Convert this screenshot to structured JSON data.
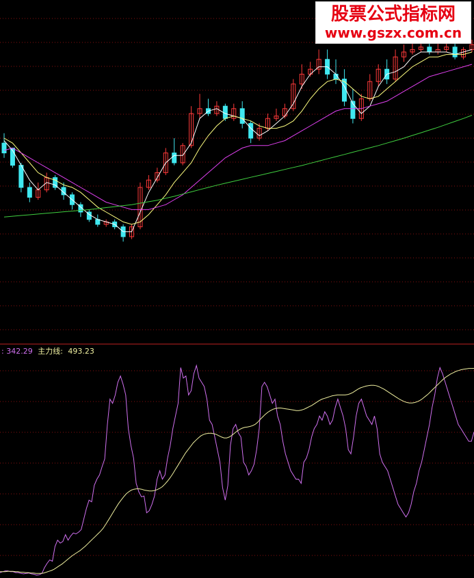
{
  "watermark": {
    "title": "股票公式指标网",
    "url": "www.gszx.com.cn"
  },
  "indicator_legend": {
    "fast_value": ": 342.29",
    "main_label": "主力线: ",
    "main_value": "493.23"
  },
  "colors": {
    "background": "#000000",
    "up": "#ff3a3a",
    "down": "#40e8f0",
    "ma_short": "#ffffff",
    "ma_mid": "#ffff80",
    "ma_long": "#e040f0",
    "ma_very_long": "#40d040",
    "fast_line": "#d070f0",
    "main_line": "#f0f0a0",
    "grid": "#8a1010",
    "separator": "#c02020"
  },
  "chart_data": [
    {
      "type": "candlestick",
      "title": "",
      "grid": true,
      "ylim": [
        0,
        100
      ],
      "candles": [
        [
          58,
          62,
          54,
          52
        ],
        [
          56,
          55,
          49,
          48
        ],
        [
          49,
          50,
          40,
          38
        ],
        [
          40,
          42,
          36,
          34
        ],
        [
          36,
          42,
          39,
          35
        ],
        [
          39,
          46,
          44,
          38
        ],
        [
          44,
          45,
          40,
          39
        ],
        [
          40,
          42,
          37,
          35
        ],
        [
          37,
          38,
          33,
          31
        ],
        [
          33,
          34,
          30,
          28
        ],
        [
          30,
          31,
          27,
          26
        ],
        [
          27,
          29,
          25,
          24
        ],
        [
          25,
          27,
          26,
          24
        ],
        [
          26,
          27,
          24,
          23
        ],
        [
          24,
          25,
          20,
          18
        ],
        [
          20,
          25,
          24,
          19
        ],
        [
          24,
          42,
          40,
          23
        ],
        [
          40,
          45,
          43,
          39
        ],
        [
          43,
          48,
          46,
          42
        ],
        [
          46,
          56,
          54,
          45
        ],
        [
          54,
          60,
          50,
          49
        ],
        [
          50,
          58,
          57,
          49
        ],
        [
          57,
          73,
          70,
          56
        ],
        [
          70,
          78,
          72,
          68
        ],
        [
          72,
          76,
          70,
          69
        ],
        [
          70,
          75,
          73,
          69
        ],
        [
          73,
          74,
          68,
          67
        ],
        [
          68,
          74,
          72,
          67
        ],
        [
          72,
          75,
          66,
          64
        ],
        [
          66,
          67,
          60,
          58
        ],
        [
          60,
          66,
          64,
          59
        ],
        [
          64,
          70,
          68,
          63
        ],
        [
          68,
          72,
          69,
          67
        ],
        [
          69,
          74,
          72,
          68
        ],
        [
          72,
          84,
          82,
          71
        ],
        [
          82,
          90,
          86,
          80
        ],
        [
          86,
          91,
          88,
          85
        ],
        [
          88,
          96,
          92,
          86
        ],
        [
          92,
          96,
          86,
          84
        ],
        [
          86,
          92,
          84,
          82
        ],
        [
          84,
          88,
          75,
          73
        ],
        [
          75,
          80,
          68,
          66
        ],
        [
          68,
          78,
          76,
          67
        ],
        [
          76,
          86,
          83,
          75
        ],
        [
          83,
          90,
          88,
          81
        ],
        [
          88,
          92,
          84,
          82
        ],
        [
          84,
          96,
          93,
          83
        ],
        [
          93,
          98,
          95,
          91
        ],
        [
          95,
          99,
          96,
          94
        ],
        [
          96,
          100,
          97,
          95
        ],
        [
          97,
          100,
          95,
          94
        ],
        [
          95,
          99,
          96,
          94
        ],
        [
          96,
          100,
          97,
          95
        ],
        [
          97,
          99,
          93,
          92
        ],
        [
          93,
          97,
          96,
          92
        ],
        [
          96,
          100,
          98,
          95
        ]
      ],
      "series": [
        {
          "name": "",
          "color": "ma_short",
          "values": [
            59,
            55,
            49,
            43,
            39,
            42,
            41,
            38,
            35,
            32,
            29,
            27,
            26,
            25,
            22,
            22,
            30,
            38,
            44,
            50,
            53,
            53,
            58,
            68,
            71,
            72,
            70,
            69,
            68,
            64,
            61,
            63,
            66,
            69,
            74,
            81,
            86,
            89,
            89,
            86,
            81,
            74,
            70,
            73,
            81,
            86,
            87,
            89,
            93,
            95,
            95,
            95,
            95,
            94,
            95,
            96
          ]
        },
        {
          "name": "",
          "color": "ma_mid",
          "values": [
            60,
            58,
            54,
            50,
            46,
            44,
            43,
            41,
            40,
            38,
            35,
            32,
            30,
            28,
            26,
            25,
            26,
            29,
            33,
            37,
            42,
            46,
            50,
            56,
            61,
            65,
            68,
            69,
            68,
            67,
            65,
            64,
            64,
            65,
            67,
            71,
            76,
            80,
            83,
            84,
            83,
            80,
            77,
            76,
            77,
            80,
            83,
            86,
            89,
            91,
            93,
            93,
            94,
            94,
            94,
            95
          ]
        },
        {
          "name": "",
          "color": "ma_long",
          "values": [
            55,
            56,
            54,
            52,
            50,
            48,
            46,
            44,
            42,
            40,
            38,
            36,
            34,
            33,
            32,
            31,
            31,
            31,
            32,
            33,
            35,
            37,
            40,
            43,
            46,
            49,
            52,
            54,
            56,
            57,
            57,
            57,
            58,
            59,
            61,
            63,
            65,
            67,
            69,
            71,
            72,
            72,
            72,
            73,
            74,
            75,
            77,
            79,
            81,
            83,
            85,
            86,
            87,
            88,
            89,
            90
          ]
        },
        {
          "name": "",
          "color": "ma_very_long",
          "values": [
            28,
            28.3,
            28.6,
            28.9,
            29.2,
            29.5,
            29.8,
            30.1,
            30.4,
            30.7,
            31,
            31.4,
            31.8,
            32.2,
            32.6,
            33,
            33.6,
            34.2,
            34.8,
            35.6,
            36.4,
            37.3,
            38.2,
            39.1,
            40,
            40.9,
            41.7,
            42.5,
            43.3,
            44.1,
            44.9,
            45.7,
            46.5,
            47.3,
            48.1,
            48.9,
            49.8,
            50.7,
            51.6,
            52.5,
            53.4,
            54.3,
            55.2,
            56.1,
            57,
            58,
            59,
            60,
            61.1,
            62.2,
            63.3,
            64.4,
            65.6,
            66.8,
            68,
            69.3
          ]
        }
      ]
    },
    {
      "type": "line",
      "title": "",
      "grid": true,
      "ylim": [
        0,
        520
      ],
      "series": [
        {
          "name": "",
          "color": "fast_line",
          "values": [
            8,
            10,
            12,
            12,
            10,
            10,
            8,
            8,
            6,
            5,
            6,
            7,
            5,
            4,
            2,
            3,
            6,
            20,
            30,
            38,
            35,
            70,
            85,
            78,
            82,
            98,
            85,
            95,
            102,
            100,
            104,
            110,
            135,
            160,
            180,
            176,
            215,
            230,
            240,
            260,
            278,
            360,
            420,
            410,
            430,
            460,
            475,
            455,
            430,
            350,
            310,
            280,
            220,
            200,
            188,
            190,
            150,
            155,
            170,
            190,
            230,
            250,
            230,
            240,
            280,
            310,
            350,
            380,
            410,
            495,
            470,
            475,
            430,
            440,
            480,
            500,
            470,
            460,
            450,
            420,
            370,
            360,
            330,
            300,
            270,
            210,
            180,
            215,
            310,
            350,
            360,
            340,
            330,
            270,
            260,
            240,
            250,
            265,
            300,
            350,
            450,
            460,
            450,
            430,
            410,
            420,
            380,
            360,
            320,
            290,
            270,
            250,
            240,
            230,
            230,
            220,
            270,
            280,
            300,
            330,
            350,
            360,
            380,
            370,
            390,
            380,
            360,
            370,
            400,
            420,
            400,
            380,
            350,
            300,
            290,
            330,
            380,
            410,
            420,
            400,
            380,
            370,
            360,
            380,
            350,
            290,
            270,
            260,
            250,
            230,
            210,
            190,
            170,
            160,
            150,
            140,
            150,
            170,
            200,
            220,
            250,
            270,
            300,
            330,
            360,
            400,
            430,
            470,
            495,
            480,
            460,
            440,
            420,
            400,
            380,
            360,
            350,
            340,
            330,
            320,
            320,
            342
          ]
        },
        {
          "name": "主力线",
          "color": "main_line",
          "values": [
            10,
            10,
            10,
            11,
            11,
            11,
            10,
            10,
            9,
            9,
            8,
            8,
            7,
            7,
            6,
            6,
            6,
            7,
            9,
            11,
            13,
            16,
            20,
            24,
            28,
            33,
            38,
            43,
            48,
            52,
            56,
            60,
            65,
            70,
            76,
            82,
            88,
            94,
            100,
            106,
            113,
            122,
            132,
            142,
            152,
            162,
            172,
            180,
            188,
            195,
            200,
            204,
            206,
            207,
            207,
            206,
            204,
            203,
            202,
            202,
            203,
            205,
            208,
            212,
            218,
            225,
            233,
            242,
            252,
            262,
            272,
            282,
            292,
            300,
            308,
            316,
            322,
            328,
            333,
            336,
            338,
            339,
            339,
            338,
            336,
            333,
            330,
            328,
            328,
            330,
            334,
            339,
            344,
            348,
            351,
            353,
            354,
            355,
            357,
            360,
            365,
            372,
            378,
            384,
            389,
            393,
            396,
            398,
            399,
            399,
            398,
            397,
            396,
            395,
            394,
            393,
            393,
            394,
            396,
            399,
            402,
            405,
            409,
            413,
            417,
            420,
            422,
            424,
            426,
            428,
            429,
            430,
            430,
            430,
            430,
            431,
            433,
            436,
            440,
            444,
            447,
            449,
            451,
            452,
            453,
            453,
            452,
            450,
            447,
            444,
            440,
            436,
            432,
            428,
            424,
            420,
            417,
            414,
            412,
            411,
            411,
            412,
            414,
            417,
            421,
            426,
            431,
            437,
            443,
            449,
            455,
            461,
            467,
            472,
            476,
            480,
            483,
            486,
            488,
            490,
            491,
            492,
            493,
            493,
            493.23
          ]
        }
      ]
    }
  ]
}
